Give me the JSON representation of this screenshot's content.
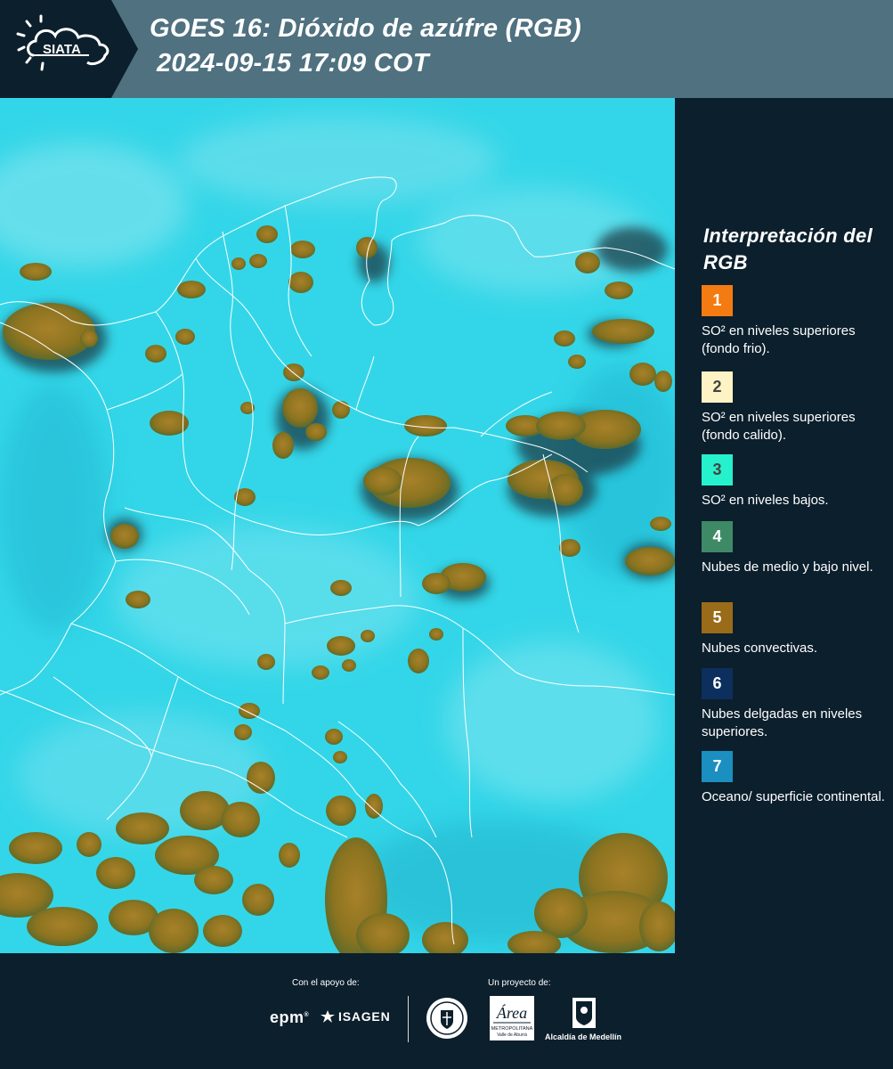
{
  "header": {
    "logo_text": "SIATA",
    "title_line1": "GOES 16: Dióxido de azúfre (RGB)",
    "title_line2": "2024-09-15 17:09 COT"
  },
  "legend": {
    "title": "Interpretación del RGB",
    "items": [
      {
        "number": "1",
        "color": "#f47b12",
        "description": "SO² en niveles superiores (fondo frio)."
      },
      {
        "number": "2",
        "color": "#fdf3c4",
        "description": "SO² en niveles superiores (fondo calido)."
      },
      {
        "number": "3",
        "color": "#26f1cd",
        "description": "SO² en niveles bajos."
      },
      {
        "number": "4",
        "color": "#3f8a66",
        "description": "Nubes de medio y bajo nivel."
      },
      {
        "number": "5",
        "color": "#9a6b18",
        "description": "Nubes convectivas."
      },
      {
        "number": "6",
        "color": "#0d2f5e",
        "description": "Nubes delgadas en niveles superiores."
      },
      {
        "number": "7",
        "color": "#1a8fc0",
        "description": "Oceano/ superficie continental."
      }
    ]
  },
  "map": {
    "background_color": "#33d6e8",
    "cloud_color": "#9a7a22",
    "shadow_color": "#1f4a50",
    "border_color": "#ffffff"
  },
  "footer": {
    "support_caption": "Con el apoyo de:",
    "project_caption": "Un proyecto de:",
    "epm_text": "epm",
    "isagen_text": "ISAGEN",
    "area_text_top": "Área",
    "area_text_mid": "METROPOLITANA",
    "area_text_bottom": "Valle de Aburrá",
    "alcaldia_text": "Alcaldía de Medellín"
  }
}
